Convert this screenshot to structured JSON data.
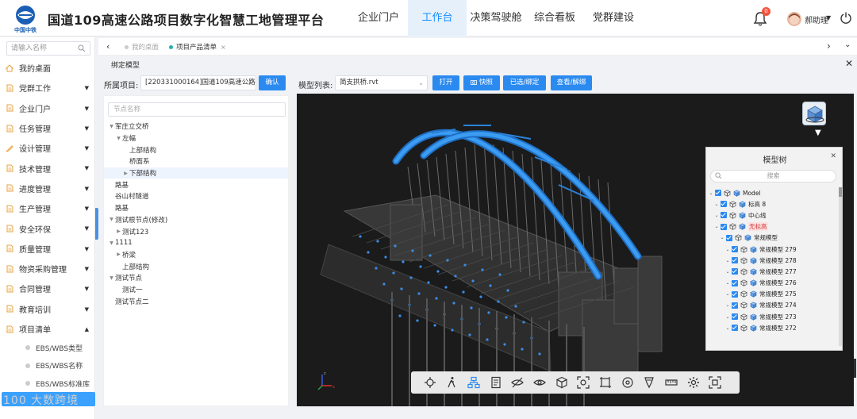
{
  "header": {
    "org_name": "中国中铁",
    "title": "国道109高速公路项目数字化智慧工地管理平台",
    "nav": [
      {
        "label": "企业门户",
        "active": false
      },
      {
        "label": "工作台",
        "active": true
      },
      {
        "label": "决策驾驶舱",
        "active": false
      },
      {
        "label": "综合看板",
        "active": false
      },
      {
        "label": "党群建设",
        "active": false
      }
    ],
    "notification_count": "0",
    "username": "郝助理"
  },
  "sidebar": {
    "search_placeholder": "请输入名称",
    "items": [
      {
        "label": "我的桌面",
        "icon": "home-icon",
        "caret": ""
      },
      {
        "label": "党群工作",
        "icon": "doc-icon",
        "caret": "▼"
      },
      {
        "label": "企业门户",
        "icon": "doc-icon",
        "caret": "▼"
      },
      {
        "label": "任务管理",
        "icon": "doc-icon",
        "caret": "▼"
      },
      {
        "label": "设计管理",
        "icon": "design-icon",
        "caret": "▼"
      },
      {
        "label": "技术管理",
        "icon": "doc-icon",
        "caret": "▼"
      },
      {
        "label": "进度管理",
        "icon": "doc-icon",
        "caret": "▼"
      },
      {
        "label": "生产管理",
        "icon": "doc-icon",
        "caret": "▼"
      },
      {
        "label": "安全环保",
        "icon": "doc-icon",
        "caret": "▼"
      },
      {
        "label": "质量管理",
        "icon": "doc-icon",
        "caret": "▼"
      },
      {
        "label": "物资采购管理",
        "icon": "doc-icon",
        "caret": "▼"
      },
      {
        "label": "合同管理",
        "icon": "doc-icon",
        "caret": "▼"
      },
      {
        "label": "教育培训",
        "icon": "doc-icon",
        "caret": "▼"
      },
      {
        "label": "项目清单",
        "icon": "doc-icon",
        "caret": "▲"
      }
    ],
    "sub_items": [
      "EBS/WBS类型",
      "EBS/WBS名称",
      "EBS/WBS标准库"
    ],
    "watermark": "100 大数跨境"
  },
  "tabs": {
    "items": [
      {
        "label": "我的桌面",
        "active": false,
        "closable": false
      },
      {
        "label": "项目产品清单",
        "active": true,
        "closable": true
      }
    ]
  },
  "panel": {
    "title": "绑定模型",
    "project_label": "所属项目:",
    "project_value": "[220331000164]国道109高速公路项目",
    "confirm_button": "确认",
    "model_list_label": "模型列表:",
    "model_value": "简支拱桥.rvt",
    "buttons": [
      "打开",
      "快照",
      "已选/绑定",
      "查看/解绑"
    ]
  },
  "tree": {
    "search_placeholder": "节点名称",
    "nodes": [
      {
        "label": "军庄立交桥",
        "level": 0,
        "toggle": "▼",
        "selected": false
      },
      {
        "label": "左幅",
        "level": 1,
        "toggle": "▼",
        "selected": false
      },
      {
        "label": "上部结构",
        "level": 2,
        "toggle": "",
        "selected": false
      },
      {
        "label": "桥面系",
        "level": 2,
        "toggle": "",
        "selected": false
      },
      {
        "label": "下部结构",
        "level": 2,
        "toggle": "▶",
        "selected": true
      },
      {
        "label": "路基",
        "level": 0,
        "toggle": "",
        "selected": false
      },
      {
        "label": "谷山村隧道",
        "level": 0,
        "toggle": "",
        "selected": false
      },
      {
        "label": "路基",
        "level": 0,
        "toggle": "",
        "selected": false
      },
      {
        "label": "测试根节点(修改)",
        "level": 0,
        "toggle": "▼",
        "selected": false
      },
      {
        "label": "测试123",
        "level": 1,
        "toggle": "▶",
        "selected": false
      },
      {
        "label": "1111",
        "level": 0,
        "toggle": "▼",
        "selected": false
      },
      {
        "label": "桥梁",
        "level": 1,
        "toggle": "▶",
        "selected": false
      },
      {
        "label": "上部结构",
        "level": 1,
        "toggle": "",
        "selected": false
      },
      {
        "label": "测试节点",
        "level": 0,
        "toggle": "▼",
        "selected": false
      },
      {
        "label": "测试一",
        "level": 1,
        "toggle": "",
        "selected": false
      },
      {
        "label": "测试节点二",
        "level": 0,
        "toggle": "",
        "selected": false
      }
    ]
  },
  "model_tree": {
    "title": "模型树",
    "search_placeholder": "搜索",
    "nodes": [
      {
        "label": "Model",
        "level": 0,
        "highlight": false
      },
      {
        "label": "标高 8",
        "level": 1,
        "highlight": false
      },
      {
        "label": "中心线",
        "level": 1,
        "highlight": false
      },
      {
        "label": "无标高",
        "level": 1,
        "highlight": true
      },
      {
        "label": "常规模型",
        "level": 2,
        "highlight": false
      },
      {
        "label": "常规模型 279",
        "level": 3,
        "highlight": false
      },
      {
        "label": "常规模型 278",
        "level": 3,
        "highlight": false
      },
      {
        "label": "常规模型 277",
        "level": 3,
        "highlight": false
      },
      {
        "label": "常规模型 276",
        "level": 3,
        "highlight": false
      },
      {
        "label": "常规模型 275",
        "level": 3,
        "highlight": false
      },
      {
        "label": "常规模型 274",
        "level": 3,
        "highlight": false
      },
      {
        "label": "常规模型 273",
        "level": 3,
        "highlight": false
      },
      {
        "label": "常规模型 272",
        "level": 3,
        "highlight": false
      }
    ]
  },
  "viewer_tools": [
    "move-icon",
    "walk-icon",
    "structure-icon",
    "properties-icon",
    "hide-icon",
    "eye-icon",
    "cube-icon",
    "focus-icon",
    "section-box-icon",
    "settings-dial-icon",
    "marker-icon",
    "ruler-icon",
    "gear-icon",
    "fullscreen-icon"
  ],
  "colors": {
    "accent": "#1890ff",
    "button": "#2b8af0",
    "arch": "#2a8de8"
  }
}
